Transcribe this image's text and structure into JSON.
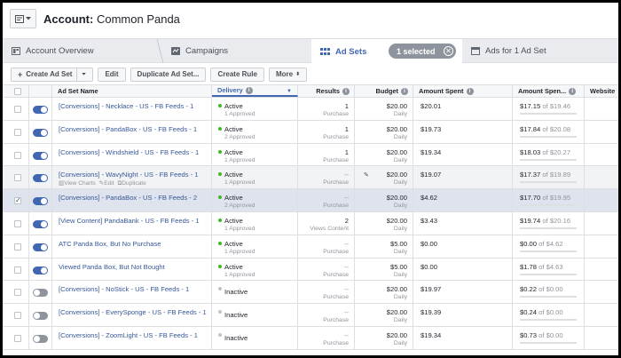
{
  "header": {
    "account_label": "Account:",
    "account_name": "Common Panda"
  },
  "tabs": [
    {
      "label": "Account Overview"
    },
    {
      "label": "Campaigns"
    },
    {
      "label": "Ad Sets"
    },
    {
      "label": "Ads for 1 Ad Set"
    }
  ],
  "selection": {
    "label": "1 selected"
  },
  "toolbar": {
    "create": "Create Ad Set",
    "edit": "Edit",
    "duplicate": "Duplicate Ad Set...",
    "rule": "Create Rule",
    "more": "More"
  },
  "columns": {
    "name": "Ad Set Name",
    "delivery": "Delivery",
    "results": "Results",
    "budget": "Budget",
    "amount": "Amount Spent",
    "amount_pct": "Amount Spen...",
    "website": "Website"
  },
  "row_actions": {
    "view": "View Charts",
    "edit": "Edit",
    "duplicate": "Duplicate"
  },
  "rows": [
    {
      "name": "[Conversions] - Necklace - US - FB Feeds - 1",
      "delivery": "Active",
      "approved": "1 Approved",
      "result": "1",
      "result_type": "Purchase",
      "budget": "$20.00",
      "budget_type": "Daily",
      "amount": "$20.01",
      "spent": "$17.15",
      "of": "of",
      "limit": "$19.46",
      "progress": 0.88,
      "on": true
    },
    {
      "name": "[Conversions] - PandaBox - US - FB Feeds - 1",
      "delivery": "Active",
      "approved": "2 Approved",
      "result": "1",
      "result_type": "Purchase",
      "budget": "$20.00",
      "budget_type": "Daily",
      "amount": "$19.73",
      "spent": "$17.84",
      "of": "of",
      "limit": "$20.08",
      "progress": 0.89,
      "on": true
    },
    {
      "name": "[Conversions] - Windshield - US - FB Feeds - 1",
      "delivery": "Active",
      "approved": "1 Approved",
      "result": "1",
      "result_type": "Purchase",
      "budget": "$20.00",
      "budget_type": "Daily",
      "amount": "$19.34",
      "spent": "$18.03",
      "of": "of",
      "limit": "$20.27",
      "progress": 0.89,
      "on": true
    },
    {
      "name": "[Conversions] - WavyNight - US - FB Feeds - 1",
      "delivery": "Active",
      "approved": "1 Approved",
      "result": "--",
      "result_type": "Purchase",
      "budget": "$20.00",
      "budget_type": "Daily",
      "amount": "$19.07",
      "spent": "$17.37",
      "of": "of",
      "limit": "$19.89",
      "progress": 0.87,
      "on": true,
      "hover": true
    },
    {
      "name": "[Conversions] - PandaBox - US - FB Feeds - 2",
      "delivery": "Active",
      "approved": "2 Approved",
      "result": "--",
      "result_type": "Purchase",
      "budget": "$20.00",
      "budget_type": "Daily",
      "amount": "$4.62",
      "spent": "$17.70",
      "of": "of",
      "limit": "$19.95",
      "progress": 0.89,
      "on": true,
      "selected": true
    },
    {
      "name": "[View Content] PandaBank - US - FB Feeds - 1",
      "delivery": "Active",
      "approved": "1 Approved",
      "result": "2",
      "result_type": "Views Content",
      "budget": "$20.00",
      "budget_type": "Daily",
      "amount": "$3.43",
      "spent": "$19.74",
      "of": "of",
      "limit": "$20.16",
      "progress": 0.98,
      "on": true
    },
    {
      "name": "ATC Panda Box, But No Purchase",
      "delivery": "Active",
      "approved": "1 Approved",
      "result": "--",
      "result_type": "Purchase",
      "budget": "$5.00",
      "budget_type": "Daily",
      "amount": "$0.00",
      "spent": "$0.00",
      "of": "of",
      "limit": "$4.62",
      "progress": 0.0,
      "on": true
    },
    {
      "name": "Viewed Panda Box, But Not Bought",
      "delivery": "Active",
      "approved": "1 Approved",
      "result": "--",
      "result_type": "Purchase",
      "budget": "$5.00",
      "budget_type": "Daily",
      "amount": "$0.00",
      "spent": "$1.78",
      "of": "of",
      "limit": "$4.63",
      "progress": 0.38,
      "on": true
    },
    {
      "name": "[Conversions] - NoStick - US - FB Feeds - 1",
      "delivery": "Inactive",
      "approved": "",
      "result": "--",
      "result_type": "Purchase",
      "budget": "$20.00",
      "budget_type": "Daily",
      "amount": "$19.97",
      "spent": "$0.22",
      "of": "of",
      "limit": "$0.00",
      "progress": 1.0,
      "on": false
    },
    {
      "name": "[Conversions] - EverySponge - US - FB Feeds - 1",
      "delivery": "Inactive",
      "approved": "",
      "result": "--",
      "result_type": "Purchase",
      "budget": "$20.00",
      "budget_type": "Daily",
      "amount": "$19.39",
      "spent": "$0.24",
      "of": "of",
      "limit": "$0.00",
      "progress": 1.0,
      "on": false
    },
    {
      "name": "[Conversions] - ZoomLight - US - FB Feeds - 1",
      "delivery": "Inactive",
      "approved": "",
      "result": "--",
      "result_type": "Purchase",
      "budget": "$20.00",
      "budget_type": "Daily",
      "amount": "$19.34",
      "spent": "$0.73",
      "of": "of",
      "limit": "$0.00",
      "progress": 1.0,
      "on": false
    }
  ],
  "colors": {
    "accent": "#4267b2",
    "link": "#365899",
    "active": "#42b72a",
    "selected_row": "#dfe3ee"
  }
}
